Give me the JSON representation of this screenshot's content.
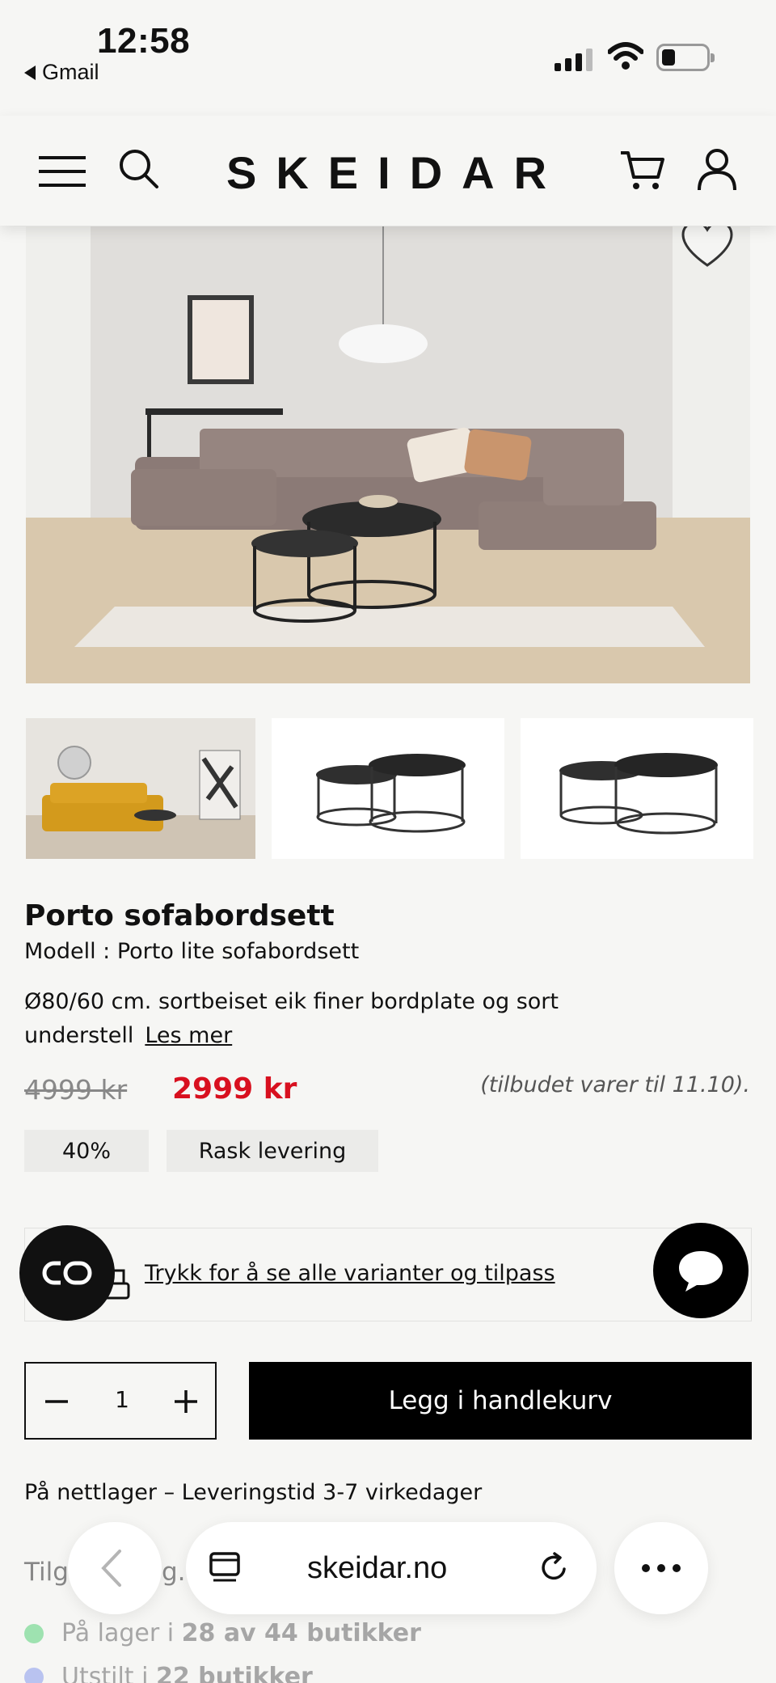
{
  "status_bar": {
    "time": "12:58",
    "back_app": "Gmail"
  },
  "header": {
    "brand": "SKEIDAR",
    "icons": [
      "menu-icon",
      "search-icon",
      "cart-icon",
      "user-icon"
    ]
  },
  "product": {
    "title": "Porto sofabordsett",
    "model": "Modell : Porto lite sofabordsett",
    "description": "Ø80/60 cm. sortbeiset eik finer bordplate og sort understell",
    "read_more": "Les mer",
    "old_price": "4999 kr",
    "new_price": "2999 kr",
    "offer_note": "(tilbudet varer til 11.10).",
    "discount_badge": "40%",
    "delivery_badge": "Rask levering",
    "price_color": "#d8101f"
  },
  "variants": {
    "link_text": "Trykk for å se alle varianter og tilpass"
  },
  "purchase": {
    "quantity": "1",
    "add_to_cart": "Legg i handlekurv"
  },
  "availability": {
    "online": "På nettlager – Leveringstid 3-7 virkedager",
    "heading_visible": "Tilg",
    "heading_visible_2": "g.",
    "in_stock_prefix": "På lager i ",
    "in_stock_count": "28 av 44 butikker",
    "displayed_prefix": "Utstilt i ",
    "displayed_count": "22 butikker",
    "in_stock_color": "#9ee2b0",
    "displayed_color": "#b9c3f0"
  },
  "browser": {
    "url": "skeidar.no"
  }
}
